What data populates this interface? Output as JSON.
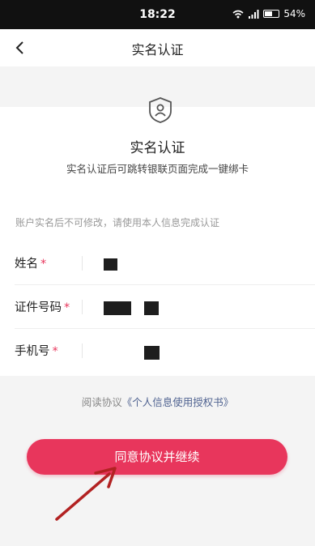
{
  "status": {
    "time": "18:22",
    "battery": "54%"
  },
  "nav": {
    "title": "实名认证"
  },
  "card": {
    "icon": "shield-user-icon",
    "title": "实名认证",
    "subtitle": "实名认证后可跳转银联页面完成一键绑卡"
  },
  "hint": "账户实名后不可修改，请使用本人信息完成认证",
  "form": {
    "name_label": "姓名",
    "id_label": "证件号码",
    "phone_label": "手机号",
    "required_mark": "*"
  },
  "agreement": {
    "prefix": "阅读协议",
    "link": "《个人信息使用授权书》"
  },
  "button": {
    "label": "同意协议并继续"
  },
  "colors": {
    "accent": "#e8365c",
    "link": "#4f6290"
  }
}
